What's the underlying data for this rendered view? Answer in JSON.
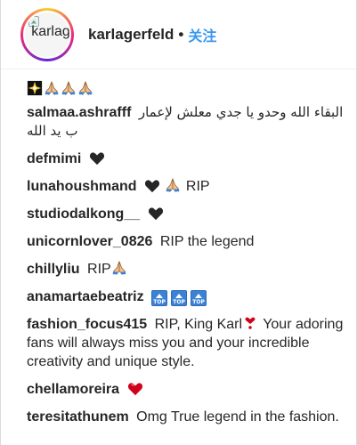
{
  "header": {
    "username": "karlagerfeld",
    "separator": "•",
    "follow_label": "关注",
    "avatar_alt": "karlag"
  },
  "comments": [
    {
      "user": "",
      "text": "",
      "emoji": [
        "sparkle-icon",
        "folded-hands-icon",
        "folded-hands-icon",
        "folded-hands-icon"
      ]
    },
    {
      "user": "salmaa.ashrafff",
      "text": "البقاء الله وحدو يا جدي معلش لإعمار ب يد الله"
    },
    {
      "user": "defmimi",
      "text": "",
      "emoji": [
        "black-heart-icon"
      ]
    },
    {
      "user": "lunahoushmand",
      "text": "RIP",
      "emoji": [
        "black-heart-icon",
        "folded-hands-icon"
      ]
    },
    {
      "user": "studiodalkong__",
      "text": "",
      "emoji": [
        "black-heart-icon"
      ]
    },
    {
      "user": "unicornlover_0826",
      "text": "RIP the legend"
    },
    {
      "user": "chillyliu",
      "text": "RIP",
      "emoji": [
        "folded-hands-icon"
      ]
    },
    {
      "user": "anamartaebeatriz",
      "text": "",
      "emoji": [
        "top-arrow-icon",
        "top-arrow-icon",
        "top-arrow-icon"
      ],
      "badge_label": "TOP"
    },
    {
      "user": "fashion_focus415",
      "text_before": "RIP, King Karl",
      "text_after": " Your adoring fans will always miss you and your incredible creativity and unique style.",
      "emoji": [
        "heart-exclamation-icon"
      ]
    },
    {
      "user": "chellamoreira",
      "text": "",
      "emoji": [
        "red-heart-icon"
      ]
    },
    {
      "user": "teresitathunem",
      "text": "Omg True legend in the fashion."
    }
  ],
  "colors": {
    "link_blue": "#3897f0",
    "text": "#262626",
    "heart_red": "#d0021b",
    "badge_blue": "#3b82d6"
  }
}
